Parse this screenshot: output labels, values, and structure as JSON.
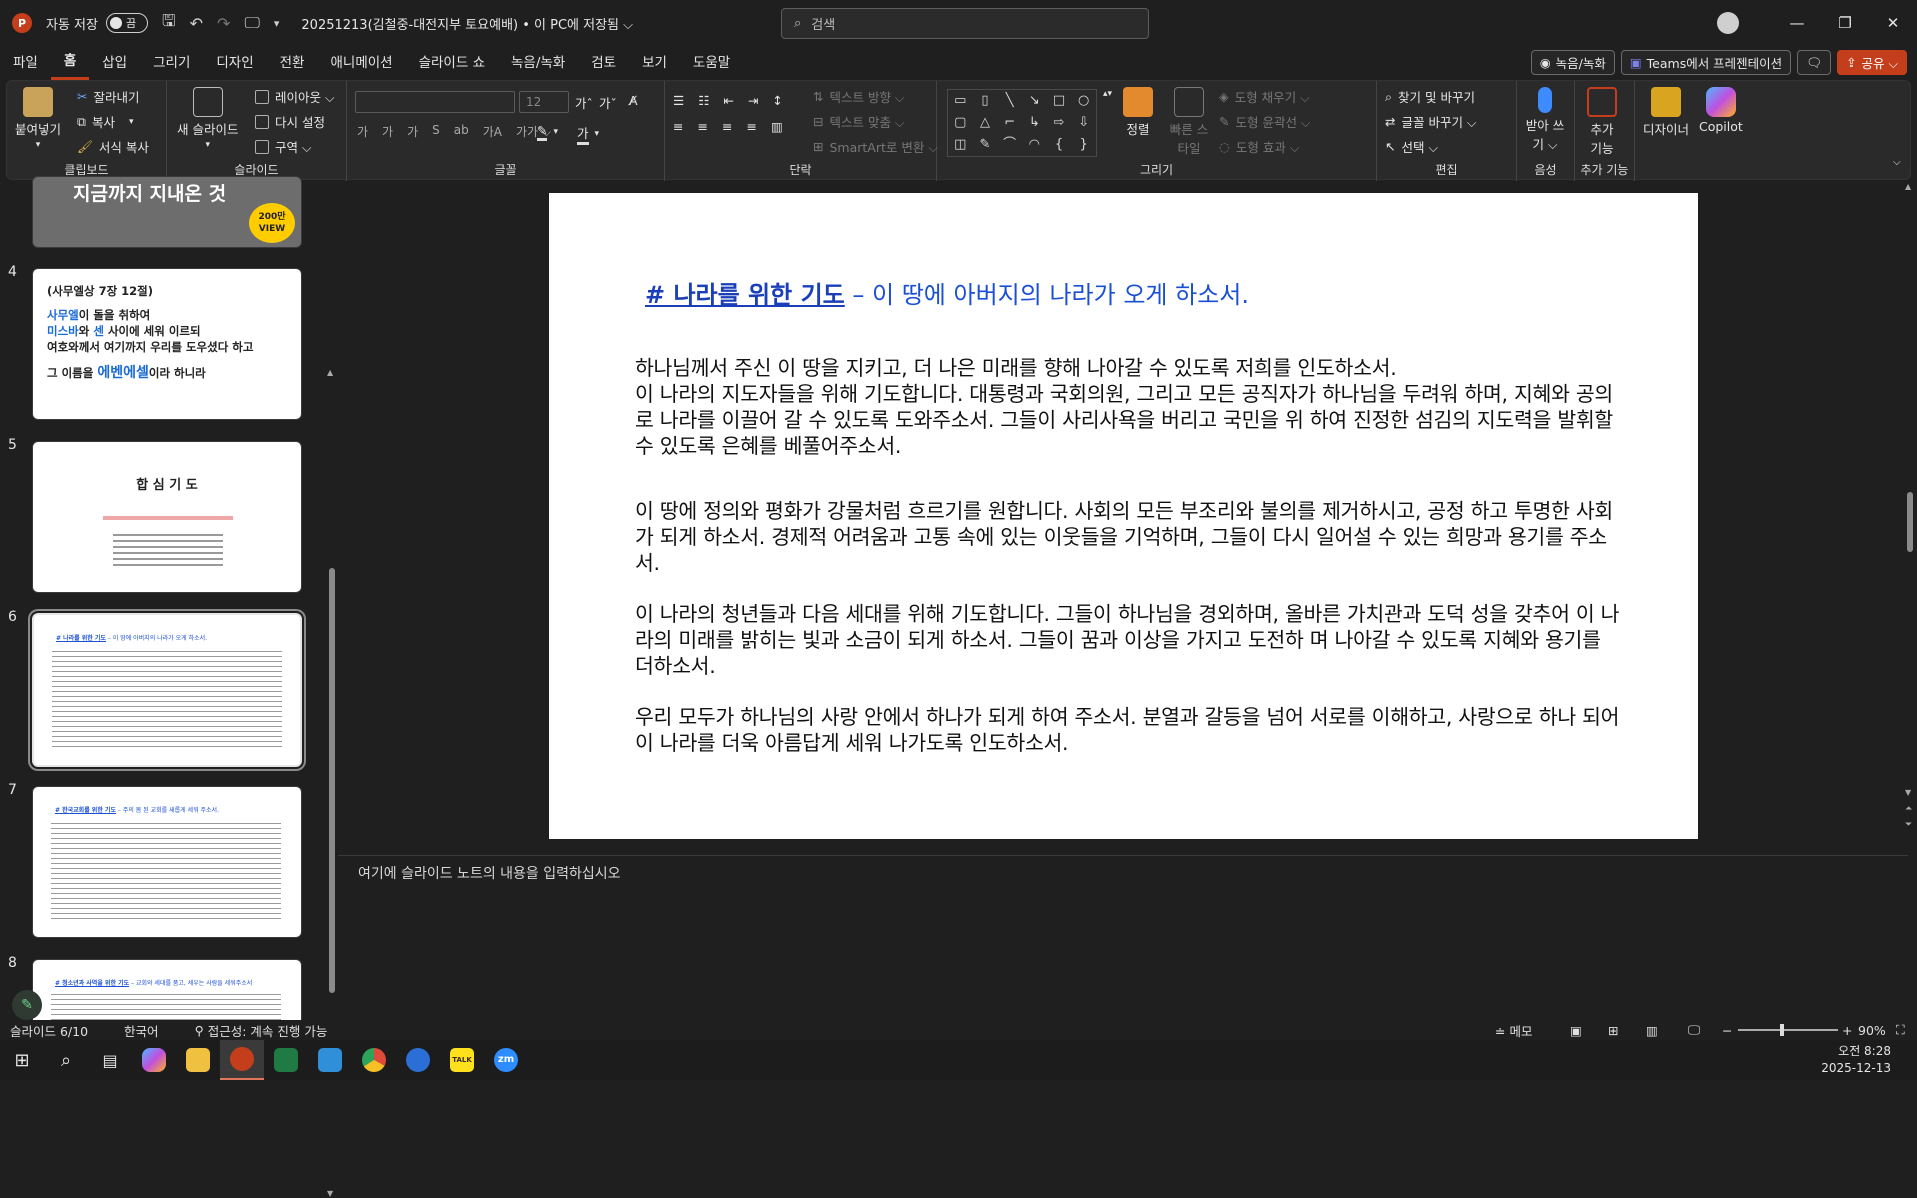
{
  "titlebar": {
    "app_logo_letter": "P",
    "autosave_label": "자동 저장",
    "autosave_state": "끔",
    "doc_title": "20251213(김철중-대전지부 토요예배) • 이 PC에 저장됨 ⌵",
    "search_placeholder": "검색",
    "minimize": "—",
    "restore": "❐",
    "close": "✕"
  },
  "menu": {
    "items": [
      "파일",
      "홈",
      "삽입",
      "그리기",
      "디자인",
      "전환",
      "애니메이션",
      "슬라이드 쇼",
      "녹음/녹화",
      "검토",
      "보기",
      "도움말"
    ],
    "active_index": 1,
    "record_button": "녹음/녹화",
    "teams_button": "Teams에서 프레젠테이션",
    "comment_icon": "comment-icon",
    "share_button": "공유 ⌵"
  },
  "ribbon": {
    "clipboard": {
      "paste": "붙여넣기",
      "cut": "잘라내기",
      "copy": "복사",
      "format_painter": "서식 복사",
      "label": "클립보드"
    },
    "slides": {
      "new_slide": "새 슬라이드",
      "layout": "레이아웃 ⌵",
      "reset": "다시 설정",
      "section": "구역 ⌵",
      "label": "슬라이드"
    },
    "font": {
      "font_size": "12",
      "label": "글꼴",
      "row2": [
        "가",
        "가",
        "가",
        "S",
        "ab",
        "가A",
        "가가 ⌵"
      ]
    },
    "paragraph": {
      "text_direction": "텍스트 방향 ⌵",
      "align_text": "텍스트 맞춤 ⌵",
      "smartart": "SmartArt로 변환 ⌵",
      "label": "단락"
    },
    "drawing": {
      "arrange": "정렬",
      "quick_styles": "빠른 스타일",
      "shape_fill": "도형 채우기 ⌵",
      "shape_outline": "도형 윤곽선 ⌵",
      "shape_effects": "도형 효과 ⌵",
      "label": "그리기"
    },
    "editing": {
      "find_replace": "찾기 및 바꾸기",
      "replace_font": "글꼴 바꾸기 ⌵",
      "select": "선택 ⌵",
      "label": "편집"
    },
    "voice": {
      "dictate": "받아 쓰기 ⌵",
      "label": "음성"
    },
    "addins": {
      "addins": "추가 기능",
      "label": "추가 기능"
    },
    "designer": "디자이너",
    "copilot": "Copilot"
  },
  "thumbnails": {
    "slide3_badge": "200만 VIEW",
    "slide3_caption": "지금까지 지내온 것",
    "slide4": {
      "num": "4",
      "l1": "(사무엘상 7장 12절)",
      "l2a": "사무엘",
      "l2b": "이 돌을 취하여",
      "l3a": "미스바",
      "l3b": "와 ",
      "l3c": "센",
      "l3d": " 사이에 세워 이르되",
      "l4": "여호와께서 여기까지 우리를 도우셨다 하고",
      "l5a": "그 이름을 ",
      "l5b": "에벤에셀",
      "l5c": "이라 하니라"
    },
    "slide5": {
      "num": "5",
      "title": "합 심 기 도"
    },
    "slide6": {
      "num": "6",
      "title": "# 나라를 위한 기도",
      "sub": "– 이 땅에 아버지의 나라가 오게 하소서."
    },
    "slide7": {
      "num": "7",
      "title": "# 한국교회를 위한 기도",
      "sub": "– 주의 몸 된 교회를 새롭게 세워 주소서."
    },
    "slide8": {
      "num": "8",
      "title": "# 청소년과 사역을 위한 기도",
      "sub": "– 교회와 세대를 품고, 세우는 사람들 세워주소서"
    }
  },
  "slide": {
    "title_bold": "# 나라를 위한 기도",
    "title_rest": " – 이 땅에 아버지의 나라가 오게 하소서.",
    "p1": "하나님께서 주신 이 땅을 지키고, 더 나은 미래를 향해 나아갈 수 있도록 저희를 인도하소서.",
    "p2": "이 나라의 지도자들을 위해 기도합니다. 대통령과 국회의원, 그리고 모든 공직자가 하나님을 두려워 하며, 지혜와 공의로 나라를 이끌어 갈 수 있도록 도와주소서. 그들이 사리사욕을 버리고 국민을 위 하여 진정한 섬김의 지도력을 발휘할 수 있도록 은혜를 베풀어주소서.",
    "p3": "이 땅에 정의와 평화가 강물처럼 흐르기를 원합니다. 사회의 모든 부조리와 불의를 제거하시고, 공정 하고 투명한 사회가 되게 하소서. 경제적 어려움과 고통 속에 있는 이웃들을 기억하며, 그들이 다시 일어설 수 있는 희망과 용기를 주소서.",
    "p4": "이 나라의 청년들과 다음 세대를 위해 기도합니다. 그들이 하나님을 경외하며, 올바른 가치관과 도덕 성을 갖추어 이 나라의 미래를 밝히는 빛과 소금이 되게 하소서. 그들이 꿈과 이상을 가지고 도전하 며 나아갈 수 있도록 지혜와 용기를 더하소서.",
    "p5": "우리 모두가 하나님의 사랑 안에서 하나가 되게 하여 주소서. 분열과 갈등을 넘어 서로를 이해하고, 사랑으로 하나 되어 이 나라를 더욱 아름답게 세워 나가도록 인도하소서."
  },
  "notes_placeholder": "여기에 슬라이드 노트의 내용을 입력하십시오",
  "status": {
    "slide_pos": "슬라이드 6/10",
    "language": "한국어",
    "accessibility": "접근성: 계속 진행 가능",
    "notes_btn": "메모",
    "zoom": "90%"
  },
  "taskbar": {
    "time": "오전 8:28",
    "date": "2025-12-13",
    "kakaotalk_label": "TALK",
    "zoom_label": "zm"
  },
  "colors": {
    "accent": "#c43e1c",
    "slide_blue": "#1a4fd6"
  }
}
